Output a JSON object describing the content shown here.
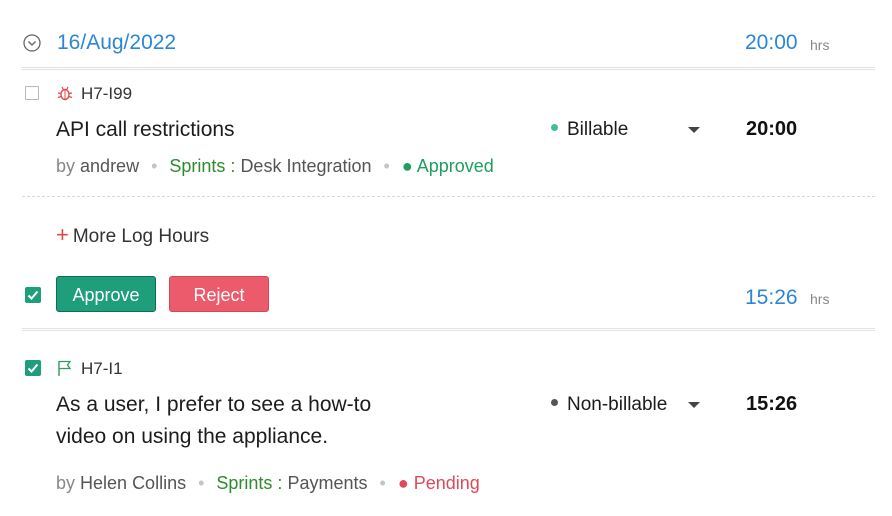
{
  "header": {
    "date": "16/Aug/2022",
    "total": "20:00",
    "hrs_label": "hrs"
  },
  "entries": [
    {
      "id": "H7-I99",
      "icon": "bug-icon",
      "title_lines": [
        "API call restrictions"
      ],
      "billing": "Billable",
      "billing_color": "#3bbfa0",
      "time": "20:00",
      "by_label": "by",
      "user": "andrew",
      "sprints_label": "Sprints :",
      "sprint": "Desk Integration",
      "status": "Approved",
      "status_color": "#1f9e5f",
      "checked": false
    },
    {
      "id": "H7-I1",
      "icon": "flag-icon",
      "title_lines": [
        "As a user, I prefer to see a how-to",
        "video on using the appliance."
      ],
      "billing": "Non-billable",
      "billing_color": "#555555",
      "time": "15:26",
      "by_label": "by",
      "user": "Helen Collins",
      "sprints_label": "Sprints :",
      "sprint": "Payments",
      "status": "Pending",
      "status_color": "#e0495a",
      "checked": true
    }
  ],
  "more_log_hours": "More Log Hours",
  "actions": {
    "approve": "Approve",
    "reject": "Reject",
    "selected_total": "15:26",
    "hrs_label": "hrs",
    "checked": true
  },
  "colors": {
    "accent_blue": "#2d86d4",
    "approve_green": "#1f9e7c",
    "reject_red": "#ec5b6b"
  }
}
